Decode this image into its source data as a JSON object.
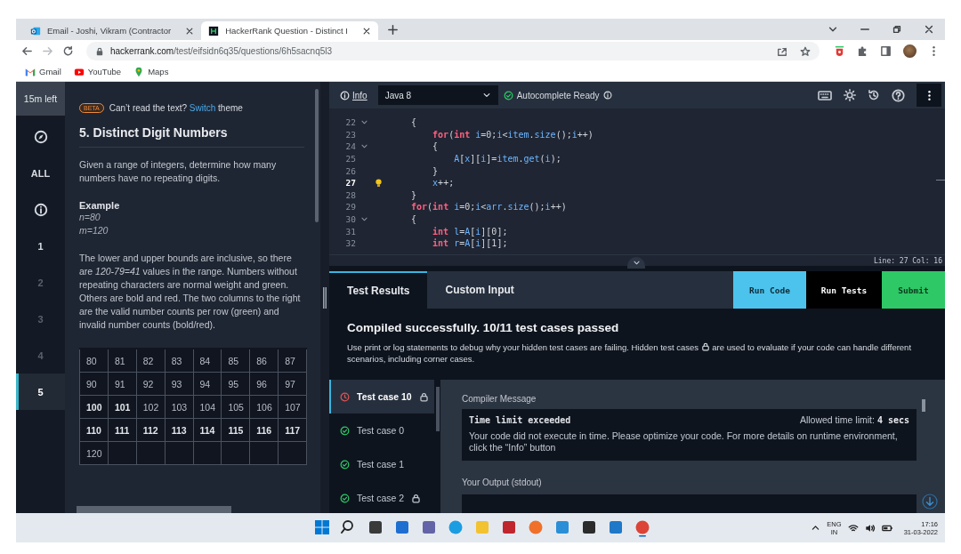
{
  "browser": {
    "tabs": [
      {
        "title": "Email - Joshi, Vikram (Contractor",
        "kind": "mail",
        "selected": false
      },
      {
        "title": "HackerRank Question - Distinct I",
        "kind": "hr",
        "selected": true
      }
    ],
    "url_host": "hackerrank.com",
    "url_path": "/test/eifsidn6q35/questions/6h5sacnq5l3",
    "bookmarks": [
      {
        "label": "Gmail",
        "kind": "gmail"
      },
      {
        "label": "YouTube",
        "kind": "youtube"
      },
      {
        "label": "Maps",
        "kind": "maps"
      }
    ]
  },
  "nav": {
    "timer": "15m left",
    "items": [
      {
        "kind": "compass",
        "selected": false,
        "dimmed": false
      },
      {
        "kind": "label",
        "label": "ALL",
        "selected": false,
        "dimmed": false
      },
      {
        "kind": "info",
        "selected": false,
        "dimmed": false
      },
      {
        "kind": "label",
        "label": "1",
        "selected": false,
        "dimmed": false
      },
      {
        "kind": "label",
        "label": "2",
        "selected": false,
        "dimmed": true
      },
      {
        "kind": "label",
        "label": "3",
        "selected": false,
        "dimmed": true
      },
      {
        "kind": "label",
        "label": "4",
        "selected": false,
        "dimmed": true
      },
      {
        "kind": "label",
        "label": "5",
        "selected": true,
        "dimmed": false
      }
    ]
  },
  "problem": {
    "badge": "BETA",
    "notice": "Can’t read the text?",
    "notice_link": "Switch",
    "notice_end": "theme",
    "title": "5. Distinct Digit Numbers",
    "intro": "Given a range of integers, determine how many numbers have no repeating digits.",
    "example_heading": "Example",
    "example_lines": [
      "n=80",
      "m=120"
    ],
    "explanation": "The lower and upper bounds are inclusive, so there are *120-79=41* values in the range. Numbers without repeating characters are normal weight and green. Others are bold and red. The two columns to the right are the valid number counts per row (green) and invalid number counts (bold/red).",
    "table": [
      [
        {
          "text": "80",
          "bold": false
        },
        {
          "text": "81",
          "bold": false
        },
        {
          "text": "82",
          "bold": false
        },
        {
          "text": "83",
          "bold": false
        },
        {
          "text": "84",
          "bold": false
        },
        {
          "text": "85",
          "bold": false
        },
        {
          "text": "86",
          "bold": false
        },
        {
          "text": "87",
          "bold": false
        }
      ],
      [
        {
          "text": "90",
          "bold": false
        },
        {
          "text": "91",
          "bold": false
        },
        {
          "text": "92",
          "bold": false
        },
        {
          "text": "93",
          "bold": false
        },
        {
          "text": "94",
          "bold": false
        },
        {
          "text": "95",
          "bold": false
        },
        {
          "text": "96",
          "bold": false
        },
        {
          "text": "97",
          "bold": false
        }
      ],
      [
        {
          "text": "100",
          "bold": true
        },
        {
          "text": "101",
          "bold": true
        },
        {
          "text": "102",
          "bold": false
        },
        {
          "text": "103",
          "bold": false
        },
        {
          "text": "104",
          "bold": false
        },
        {
          "text": "105",
          "bold": false
        },
        {
          "text": "106",
          "bold": false
        },
        {
          "text": "107",
          "bold": false
        }
      ],
      [
        {
          "text": "110",
          "bold": true
        },
        {
          "text": "111",
          "bold": true
        },
        {
          "text": "112",
          "bold": true
        },
        {
          "text": "113",
          "bold": true
        },
        {
          "text": "114",
          "bold": true
        },
        {
          "text": "115",
          "bold": true
        },
        {
          "text": "116",
          "bold": true
        },
        {
          "text": "117",
          "bold": true
        }
      ],
      [
        {
          "text": "120",
          "bold": false
        }
      ]
    ]
  },
  "editor": {
    "info_label": "Info",
    "language": "Java 8",
    "autocomplete": "Autocomplete Ready",
    "lines": [
      {
        "number": "22",
        "fold": true,
        "hint": false,
        "current": false,
        "tokens": [
          {
            "kind": "p",
            "text": "{"
          }
        ]
      },
      {
        "number": "23",
        "fold": false,
        "hint": false,
        "current": false,
        "tokens": [
          {
            "kind": "kw",
            "text": "    for"
          },
          {
            "kind": "p",
            "text": "("
          },
          {
            "kind": "kw",
            "text": "int "
          },
          {
            "kind": "id",
            "text": "i"
          },
          {
            "kind": "p",
            "text": "=0;"
          },
          {
            "kind": "id",
            "text": "i"
          },
          {
            "kind": "p",
            "text": "<"
          },
          {
            "kind": "id",
            "text": "item"
          },
          {
            "kind": "p",
            "text": "."
          },
          {
            "kind": "id",
            "text": "size"
          },
          {
            "kind": "p",
            "text": "();"
          },
          {
            "kind": "id",
            "text": "i"
          },
          {
            "kind": "p",
            "text": "++)"
          }
        ]
      },
      {
        "number": "24",
        "fold": true,
        "hint": false,
        "current": false,
        "tokens": [
          {
            "kind": "p",
            "text": "    {"
          }
        ]
      },
      {
        "number": "25",
        "fold": false,
        "hint": false,
        "current": false,
        "tokens": [
          {
            "kind": "id",
            "text": "        A"
          },
          {
            "kind": "p",
            "text": "["
          },
          {
            "kind": "id",
            "text": "x"
          },
          {
            "kind": "p",
            "text": "]["
          },
          {
            "kind": "id",
            "text": "i"
          },
          {
            "kind": "p",
            "text": "]="
          },
          {
            "kind": "id",
            "text": "item"
          },
          {
            "kind": "p",
            "text": "."
          },
          {
            "kind": "id",
            "text": "get"
          },
          {
            "kind": "p",
            "text": "("
          },
          {
            "kind": "id",
            "text": "i"
          },
          {
            "kind": "p",
            "text": ");"
          }
        ]
      },
      {
        "number": "26",
        "fold": false,
        "hint": false,
        "current": false,
        "tokens": [
          {
            "kind": "p",
            "text": "    }"
          }
        ]
      },
      {
        "number": "27",
        "fold": false,
        "hint": true,
        "current": true,
        "tokens": [
          {
            "kind": "id",
            "text": "    x"
          },
          {
            "kind": "p",
            "text": "++;"
          }
        ]
      },
      {
        "number": "28",
        "fold": false,
        "hint": false,
        "current": false,
        "tokens": [
          {
            "kind": "p",
            "text": "}"
          }
        ]
      },
      {
        "number": "29",
        "fold": false,
        "hint": false,
        "current": false,
        "tokens": [
          {
            "kind": "kw",
            "text": "for"
          },
          {
            "kind": "p",
            "text": "("
          },
          {
            "kind": "kw",
            "text": "int "
          },
          {
            "kind": "id",
            "text": "i"
          },
          {
            "kind": "p",
            "text": "=0;"
          },
          {
            "kind": "id",
            "text": "i"
          },
          {
            "kind": "p",
            "text": "<"
          },
          {
            "kind": "id",
            "text": "arr"
          },
          {
            "kind": "p",
            "text": "."
          },
          {
            "kind": "id",
            "text": "size"
          },
          {
            "kind": "p",
            "text": "();"
          },
          {
            "kind": "id",
            "text": "i"
          },
          {
            "kind": "p",
            "text": "++)"
          }
        ]
      },
      {
        "number": "30",
        "fold": true,
        "hint": false,
        "current": false,
        "tokens": [
          {
            "kind": "p",
            "text": "{"
          }
        ]
      },
      {
        "number": "31",
        "fold": false,
        "hint": false,
        "current": false,
        "tokens": [
          {
            "kind": "kw",
            "text": "    int "
          },
          {
            "kind": "id",
            "text": "l"
          },
          {
            "kind": "p",
            "text": "="
          },
          {
            "kind": "id",
            "text": "A"
          },
          {
            "kind": "p",
            "text": "["
          },
          {
            "kind": "id",
            "text": "i"
          },
          {
            "kind": "p",
            "text": "][0];"
          }
        ]
      },
      {
        "number": "32",
        "fold": false,
        "hint": false,
        "current": false,
        "tokens": [
          {
            "kind": "kw",
            "text": "    int "
          },
          {
            "kind": "id",
            "text": "r"
          },
          {
            "kind": "p",
            "text": "="
          },
          {
            "kind": "id",
            "text": "A"
          },
          {
            "kind": "p",
            "text": "["
          },
          {
            "kind": "id",
            "text": "i"
          },
          {
            "kind": "p",
            "text": "][1];"
          }
        ]
      }
    ],
    "position": "Line: 27 Col: 16"
  },
  "results": {
    "tabs": [
      {
        "label": "Test Results",
        "selected": true
      },
      {
        "label": "Custom Input",
        "selected": false
      }
    ],
    "buttons": [
      {
        "label": "Run Code",
        "kind": "run"
      },
      {
        "label": "Run Tests",
        "kind": "tests"
      },
      {
        "label": "Submit",
        "kind": "submit"
      }
    ],
    "heading": "Compiled successfully. 10/11 test cases passed",
    "hint_start": "Use print or log statements to debug why your hidden test cases are failing. Hidden test cases",
    "hint_end": "are used to evaluate if your code can handle different scenarios, including corner cases.",
    "cases": [
      {
        "label": "Test case 10",
        "passed": false,
        "locked": true,
        "selected": true
      },
      {
        "label": "Test case 0",
        "passed": true,
        "locked": false,
        "selected": false
      },
      {
        "label": "Test case 1",
        "passed": true,
        "locked": false,
        "selected": false
      },
      {
        "label": "Test case 2",
        "passed": true,
        "locked": true,
        "selected": false
      }
    ],
    "compiler_label": "Compiler Message",
    "error_title": "Time limit exceeded",
    "limit_label": "Allowed time limit:",
    "limit_value": "4 secs",
    "error_message": "Your code did not execute in time. Please optimize your code. For more details on runtime environment, click the “Info” button",
    "output_label": "Your Output (stdout)"
  },
  "taskbar": {
    "apps": [
      {
        "kind": "start",
        "active": false
      },
      {
        "kind": "search",
        "active": false
      },
      {
        "kind": "tile",
        "color": "#3a3a3a",
        "active": false
      },
      {
        "kind": "tile",
        "color": "#1f6fd1",
        "active": false
      },
      {
        "kind": "tile",
        "color": "#6264a7",
        "active": false
      },
      {
        "kind": "circle",
        "color": "#1b9de2",
        "active": false
      },
      {
        "kind": "tile",
        "color": "#f2c230",
        "active": false
      },
      {
        "kind": "tile",
        "color": "#c0262d",
        "active": false
      },
      {
        "kind": "circle",
        "color": "#f0702a",
        "active": false
      },
      {
        "kind": "tile",
        "color": "#2a8fd6",
        "active": false
      },
      {
        "kind": "tile",
        "color": "#2b2b2b",
        "active": false
      },
      {
        "kind": "tile",
        "color": "#1f78c8",
        "active": false
      },
      {
        "kind": "circle",
        "color": "#db4437",
        "active": true
      }
    ],
    "lang": "ENG",
    "region": "IN",
    "time": "17:16",
    "date": "31-03-2022"
  }
}
